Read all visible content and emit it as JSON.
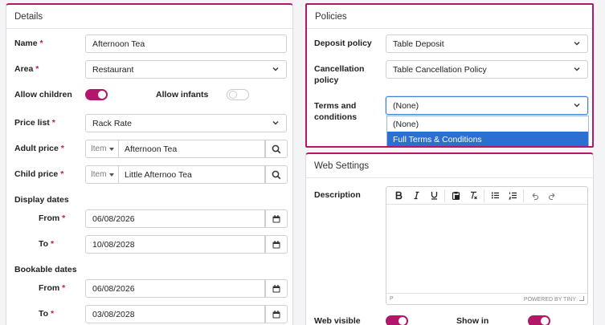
{
  "details": {
    "title": "Details",
    "name_label": "Name",
    "name_value": "Afternoon Tea",
    "area_label": "Area",
    "area_value": "Restaurant",
    "allow_children_label": "Allow children",
    "allow_children_on": true,
    "allow_infants_label": "Allow infants",
    "allow_infants_on": false,
    "price_list_label": "Price list",
    "price_list_value": "Rack Rate",
    "adult_price_label": "Adult price",
    "adult_item_type": "Item",
    "adult_item_value": "Afternoon Tea",
    "child_price_label": "Child price",
    "child_item_type": "Item",
    "child_item_value": "Little Afternoo Tea",
    "display_dates_label": "Display dates",
    "display_from_label": "From",
    "display_from_value": "06/08/2026",
    "display_to_label": "To",
    "display_to_value": "10/08/2028",
    "bookable_dates_label": "Bookable dates",
    "bookable_from_label": "From",
    "bookable_from_value": "06/08/2026",
    "bookable_to_label": "To",
    "bookable_to_value": "03/08/2028",
    "required_marker": "*"
  },
  "policies": {
    "title": "Policies",
    "deposit_label": "Deposit policy",
    "deposit_value": "Table Deposit",
    "cancellation_label_1": "Cancellation",
    "cancellation_label_2": "policy",
    "cancellation_value": "Table Cancellation Policy",
    "terms_label_1": "Terms and",
    "terms_label_2": "conditions",
    "terms_value": "(None)",
    "terms_options": [
      "(None)",
      "Full Terms & Conditions"
    ]
  },
  "web": {
    "title": "Web Settings",
    "description_label": "Description",
    "editor_path": "P",
    "editor_brand": "POWERED BY TINY",
    "web_visible_label": "Web visible",
    "web_visible_on": true,
    "show_in_label": "Show in",
    "show_in_on": true
  },
  "colors": {
    "accent": "#b3176a",
    "selected_option": "#2a6fd1",
    "focus_border": "#3f7fd6"
  }
}
